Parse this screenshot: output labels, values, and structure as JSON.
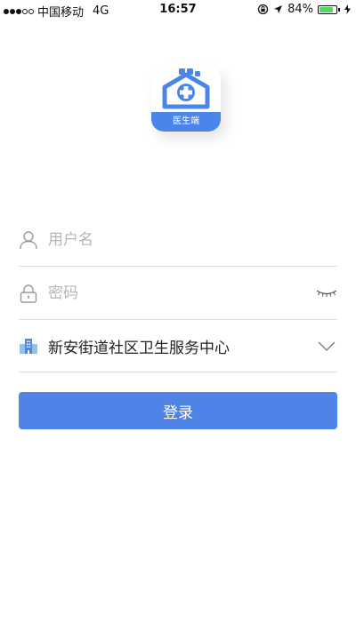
{
  "status_bar": {
    "carrier": "中国移动",
    "network": "4G",
    "time": "16:57",
    "battery_percent": "84%",
    "battery_level": 0.84,
    "icons": [
      "signal-dots-icon",
      "rotation-lock-icon",
      "location-arrow-icon",
      "battery-icon",
      "charging-icon"
    ]
  },
  "logo": {
    "badge_text": "医生端",
    "icon": "hospital-house-icon",
    "color": "#4a86e8"
  },
  "form": {
    "username": {
      "placeholder": "用户名",
      "value": "",
      "icon": "user-icon"
    },
    "password": {
      "placeholder": "密码",
      "value": "",
      "icon": "lock-icon",
      "toggle_icon": "eye-closed-icon"
    },
    "organization": {
      "value": "新安街道社区卫生服务中心",
      "icon": "building-icon",
      "dropdown_icon": "chevron-down-icon"
    }
  },
  "login_button": {
    "label": "登录",
    "color": "#4f83e8"
  }
}
